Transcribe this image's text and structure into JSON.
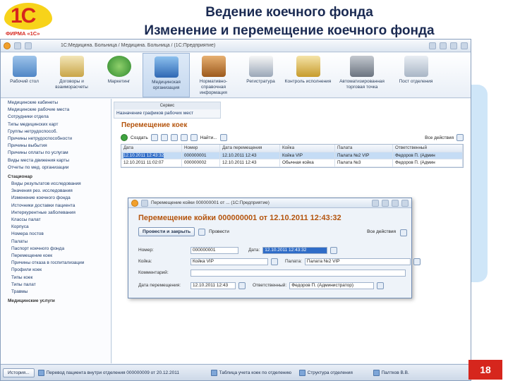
{
  "logo": {
    "mark": "1С",
    "text": "ФИРМА «1С»"
  },
  "slide": {
    "title_line1": "Ведение коечного фонда",
    "title_line2": "Изменение и перемещение коечного фонда",
    "page_number": "18"
  },
  "window": {
    "caption": "1С:Медицина. Больница / Медицина. Больница / (1С:Предприятие)"
  },
  "sections": [
    {
      "label": "Рабочий стол",
      "icon": "desktop-icon"
    },
    {
      "label": "Договоры и взаиморасчеты",
      "icon": "contracts-icon"
    },
    {
      "label": "Маркетинг",
      "icon": "marketing-icon"
    },
    {
      "label": "Медицинская организация",
      "icon": "medical-org-icon"
    },
    {
      "label": "Нормативно-справочная информация",
      "icon": "reference-icon"
    },
    {
      "label": "Регистратура",
      "icon": "registry-icon"
    },
    {
      "label": "Контроль исполнения",
      "icon": "control-icon"
    },
    {
      "label": "Автоматизированная торговая точка",
      "icon": "cash-register-icon"
    },
    {
      "label": "Пост отделения",
      "icon": "bed-icon"
    }
  ],
  "left_panel": {
    "items": [
      "Медицинские кабинеты",
      "Медицинские рабочие места",
      "Сотрудники отдела",
      "Типы медицинских карт",
      "Группы нетрудоспособ.",
      "Причины нетрудоспособности",
      "Причины выбытия",
      "Причины оплаты по услугам",
      "Виды места движения карты",
      "Отчеты по мед. организации"
    ],
    "section_stationary": "Стационар",
    "stationary_items": [
      "Виды результатов исследования",
      "Значения рез. исследования",
      "Изменение коечного фонда",
      "Источники доставки пациента",
      "Интеркурентные заболевания",
      "Классы палат",
      "Корпуса",
      "Номера постов",
      "Палаты",
      "Паспорт коечного фонда",
      "Перемещение коек",
      "Причины отказа в госпитализации",
      "Профили коек",
      "Типы коек",
      "Типы палат",
      "Травмы"
    ],
    "section_services": "Медицинские услуги"
  },
  "service": {
    "header": "Сервис",
    "link": "Назначение графиков рабочих мест"
  },
  "list": {
    "title": "Перемещение коек",
    "create_label": "Создать",
    "find_label": "Найти...",
    "all_actions_label": "Все действия",
    "columns": [
      "Дата",
      "Номер",
      "Дата перемещения",
      "Койка",
      "Палата",
      "Ответственный"
    ],
    "rows": [
      {
        "date": "12.10.2011 12:43:32",
        "number": "000000001",
        "move_date": "12.10.2011 12:43",
        "bed": "Койка VIP",
        "ward": "Палата №2 VIP",
        "responsible": "Федоров П. (Админ"
      },
      {
        "date": "12.10.2011 11:02:07",
        "number": "000000002",
        "move_date": "12.10.2011 12:43",
        "bed": "Обычная койка",
        "ward": "Палата №3",
        "responsible": "Федоров П. (Админ"
      }
    ]
  },
  "doc_form": {
    "caption": "Перемещение койки 000000001 от ... (1С:Предприятие)",
    "heading": "Перемещение койки 000000001 от 12.10.2011 12:43:32",
    "all_actions_label": "Все действия",
    "post_close_label": "Провести и закрыть",
    "post_label": "Провести",
    "number_label": "Номер:",
    "number_value": "000000001",
    "date_label": "Дата:",
    "date_value": "12.10.2011 12:43:32",
    "bed_label": "Койка:",
    "bed_value": "Койка VIP",
    "ward_label": "Палата:",
    "ward_value": "Палата №2 VIP",
    "comment_label": "Комментарий:",
    "comment_value": "",
    "move_date_label": "Дата перемещения:",
    "move_date_value": "12.10.2011 12:43",
    "responsible_label": "Ответственный:",
    "responsible_value": "Федоров П. (Администратор)"
  },
  "taskbar": {
    "history_label": "История...",
    "tasks": [
      "Перевод пациента внутри отделения 000000009 от 20.12.2011",
      "Таблица учета коек по отделению",
      "Структура отделения",
      "Палтков В.В."
    ]
  },
  "colors": {
    "heading_orange": "#b4540d",
    "brand_red": "#d6261d",
    "brand_yellow": "#f7d31a",
    "selection_blue": "#2f6cc7"
  }
}
